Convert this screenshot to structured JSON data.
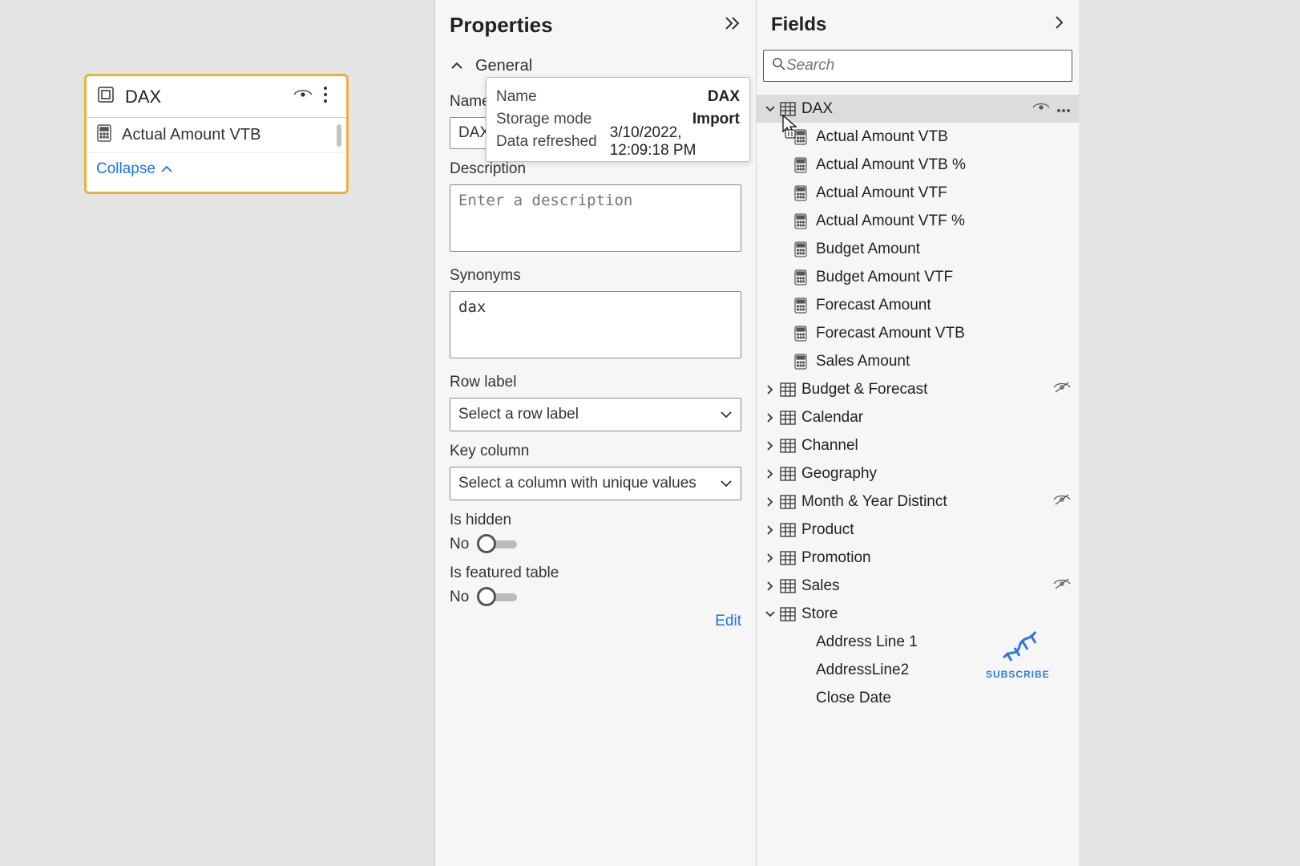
{
  "canvas": {
    "table_card": {
      "title": "DAX",
      "first_measure": "Actual Amount VTB",
      "collapse": "Collapse"
    }
  },
  "tooltip": {
    "name_k": "Name",
    "name_v": "DAX",
    "mode_k": "Storage mode",
    "mode_v": "Import",
    "refresh_k": "Data refreshed",
    "refresh_v": "3/10/2022, 12:09:18 PM"
  },
  "props": {
    "title": "Properties",
    "section_general": "General",
    "name_label": "Name",
    "name_value": "DAX",
    "desc_label": "Description",
    "desc_placeholder": "Enter a description",
    "syn_label": "Synonyms",
    "syn_value": "dax",
    "rowlabel_label": "Row label",
    "rowlabel_value": "Select a row label",
    "keycol_label": "Key column",
    "keycol_value": "Select a column with unique values",
    "ishidden_label": "Is hidden",
    "ishidden_value": "No",
    "featured_label": "Is featured table",
    "featured_value": "No",
    "edit": "Edit"
  },
  "fields": {
    "title": "Fields",
    "search_placeholder": "Search",
    "tables": [
      {
        "name": "DAX",
        "expanded": true,
        "selected": true,
        "measures": [
          "Actual Amount VTB",
          "Actual Amount VTB %",
          "Actual Amount VTF",
          "Actual Amount VTF %",
          "Budget Amount",
          "Budget Amount VTF",
          "Forecast Amount",
          "Forecast Amount VTB",
          "Sales Amount"
        ]
      },
      {
        "name": "Budget & Forecast",
        "hidden": true
      },
      {
        "name": "Calendar"
      },
      {
        "name": "Channel"
      },
      {
        "name": "Geography"
      },
      {
        "name": "Month & Year Distinct",
        "hidden": true
      },
      {
        "name": "Product"
      },
      {
        "name": "Promotion"
      },
      {
        "name": "Sales",
        "hidden": true
      },
      {
        "name": "Store",
        "expanded": true,
        "columns": [
          "Address Line 1",
          "AddressLine2",
          "Close Date"
        ]
      }
    ]
  },
  "subscribe": "SUBSCRIBE"
}
